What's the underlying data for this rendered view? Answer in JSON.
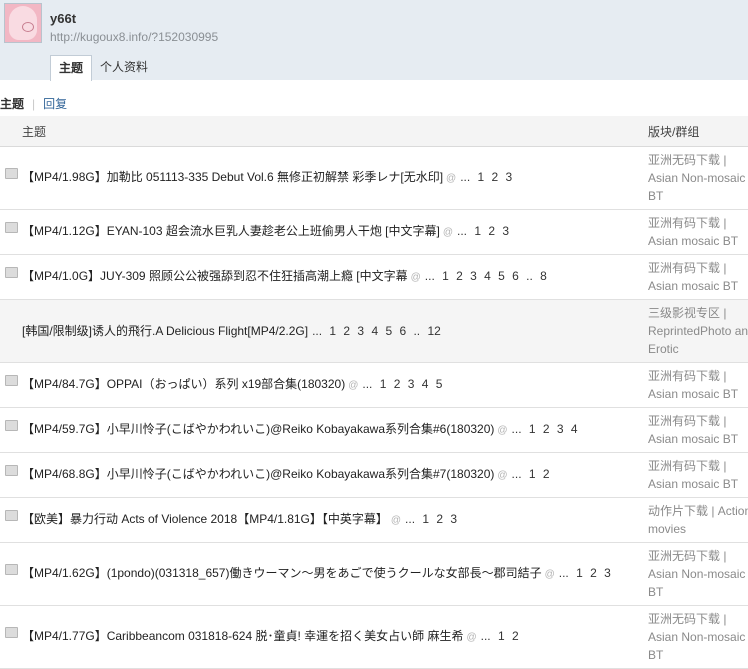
{
  "user": {
    "name": "y66t",
    "url": "http://kugoux8.info/?152030995"
  },
  "tabs": [
    "主题",
    "个人资料"
  ],
  "subnav": {
    "current": "主题",
    "sep": "|",
    "reply": "回复"
  },
  "table": {
    "col_topic": "主题",
    "col_forum": "版块/群组",
    "rows": [
      {
        "title": "【MP4/1.98G】加勒比 051113-335 Debut Vol.6 無修正初解禁 彩季レナ[无水印]",
        "pages": "... 1 2 3",
        "forum": [
          "亚洲无码下载 |",
          "Asian Non-mosaic",
          "BT"
        ]
      },
      {
        "title": "【MP4/1.12G】EYAN-103 超会流水巨乳人妻趁老公上班偷男人干炮 [中文字幕]",
        "pages": "... 1 2 3",
        "forum": [
          "亚洲有码下载 |",
          "Asian mosaic BT"
        ]
      },
      {
        "title": "【MP4/1.0G】JUY-309 照顾公公被强舔到忍不住狂插高潮上瘾 [中文字幕",
        "pages": "... 1 2 3 4 5 6 .. 8",
        "forum": [
          "亚洲有码下载 |",
          "Asian mosaic BT"
        ]
      },
      {
        "title": "[韩国/限制级]诱人的飛行.A Delicious Flight[MP4/2.2G]",
        "pages": "... 1 2 3 4 5 6 .. 12",
        "forum": [
          "三级影视专区 |",
          "ReprintedPhoto and",
          "Erotic"
        ],
        "alt": true
      },
      {
        "title": "【MP4/84.7G】OPPAI（おっぱい）系列 x19部合集(180320)",
        "pages": "... 1 2 3 4 5",
        "forum": [
          "亚洲有码下载 |",
          "Asian mosaic BT"
        ]
      },
      {
        "title": "【MP4/59.7G】小早川怜子(こばやかわれいこ)@Reiko Kobayakawa系列合集#6(180320)",
        "pages": "... 1 2 3 4",
        "forum": [
          "亚洲有码下载 |",
          "Asian mosaic BT"
        ]
      },
      {
        "title": "【MP4/68.8G】小早川怜子(こばやかわれいこ)@Reiko Kobayakawa系列合集#7(180320)",
        "pages": "... 1 2",
        "forum": [
          "亚洲有码下载 |",
          "Asian mosaic BT"
        ]
      },
      {
        "title": "【欧美】暴力行动 Acts of Violence 2018【MP4/1.81G】【中英字幕】",
        "pages": "... 1 2 3",
        "forum": [
          "动作片下载 | Action",
          "movies"
        ]
      },
      {
        "title": "【MP4/1.62G】(1pondo)(031318_657)働きウーマン〜男をあごで使うクールな女部長〜郡司結子",
        "pages": "... 1 2 3",
        "forum": [
          "亚洲无码下载 |",
          "Asian Non-mosaic",
          "BT"
        ]
      },
      {
        "title": "【MP4/1.77G】Caribbeancom 031818-624 脱･童貞! 幸運を招く美女占い師 麻生希",
        "pages": "... 1 2",
        "forum": [
          "亚洲无码下载 |",
          "Asian Non-mosaic",
          "BT"
        ]
      }
    ]
  },
  "icons": {
    "topic": "folder-icon",
    "attachment": "attachment-icon"
  }
}
